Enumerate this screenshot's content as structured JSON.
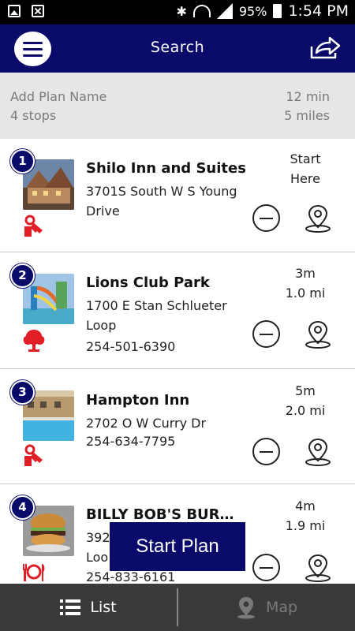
{
  "status_bar": {
    "battery": "95%",
    "time": "1:54 PM",
    "icons": [
      "image-icon",
      "close-icon",
      "bluetooth-icon",
      "wifi-icon",
      "signal-icon",
      "battery-icon"
    ]
  },
  "header": {
    "title": "Search",
    "menu_icon": "menu-icon",
    "share_icon": "share-icon"
  },
  "plan": {
    "name_placeholder": "Add Plan Name",
    "stops": "4 stops",
    "time": "12 min",
    "distance": "5 miles"
  },
  "stops": [
    {
      "number": "1",
      "name": "Shilo Inn and Suites",
      "address": "3701S South W S Young Drive",
      "phone": "",
      "time": "Start",
      "distance": "Here",
      "category_icon": "lodging-key-icon"
    },
    {
      "number": "2",
      "name": "Lions Club Park",
      "address": "1700 E Stan Schlueter Loop",
      "phone": "254-501-6390",
      "time": "3m",
      "distance": "1.0 mi",
      "category_icon": "park-tree-icon"
    },
    {
      "number": "3",
      "name": "Hampton Inn",
      "address": "2702 O W Curry Dr",
      "phone": "254-634-7795",
      "time": "5m",
      "distance": "2.0 mi",
      "category_icon": "lodging-key-icon"
    },
    {
      "number": "4",
      "name": "BILLY BOB'S BURG...",
      "address": "392",
      "address2": "Loo",
      "phone": "254-833-6161",
      "time": "4m",
      "distance": "1.9 mi",
      "category_icon": "restaurant-icon"
    }
  ],
  "start_plan_label": "Start Plan",
  "bottom_nav": {
    "list_label": "List",
    "map_label": "Map"
  },
  "colors": {
    "brand_navy": "#0a0a6b",
    "category_red": "#e01e25",
    "plan_bar_bg": "#e6e6e6",
    "nav_bg": "#3a3a3a"
  }
}
